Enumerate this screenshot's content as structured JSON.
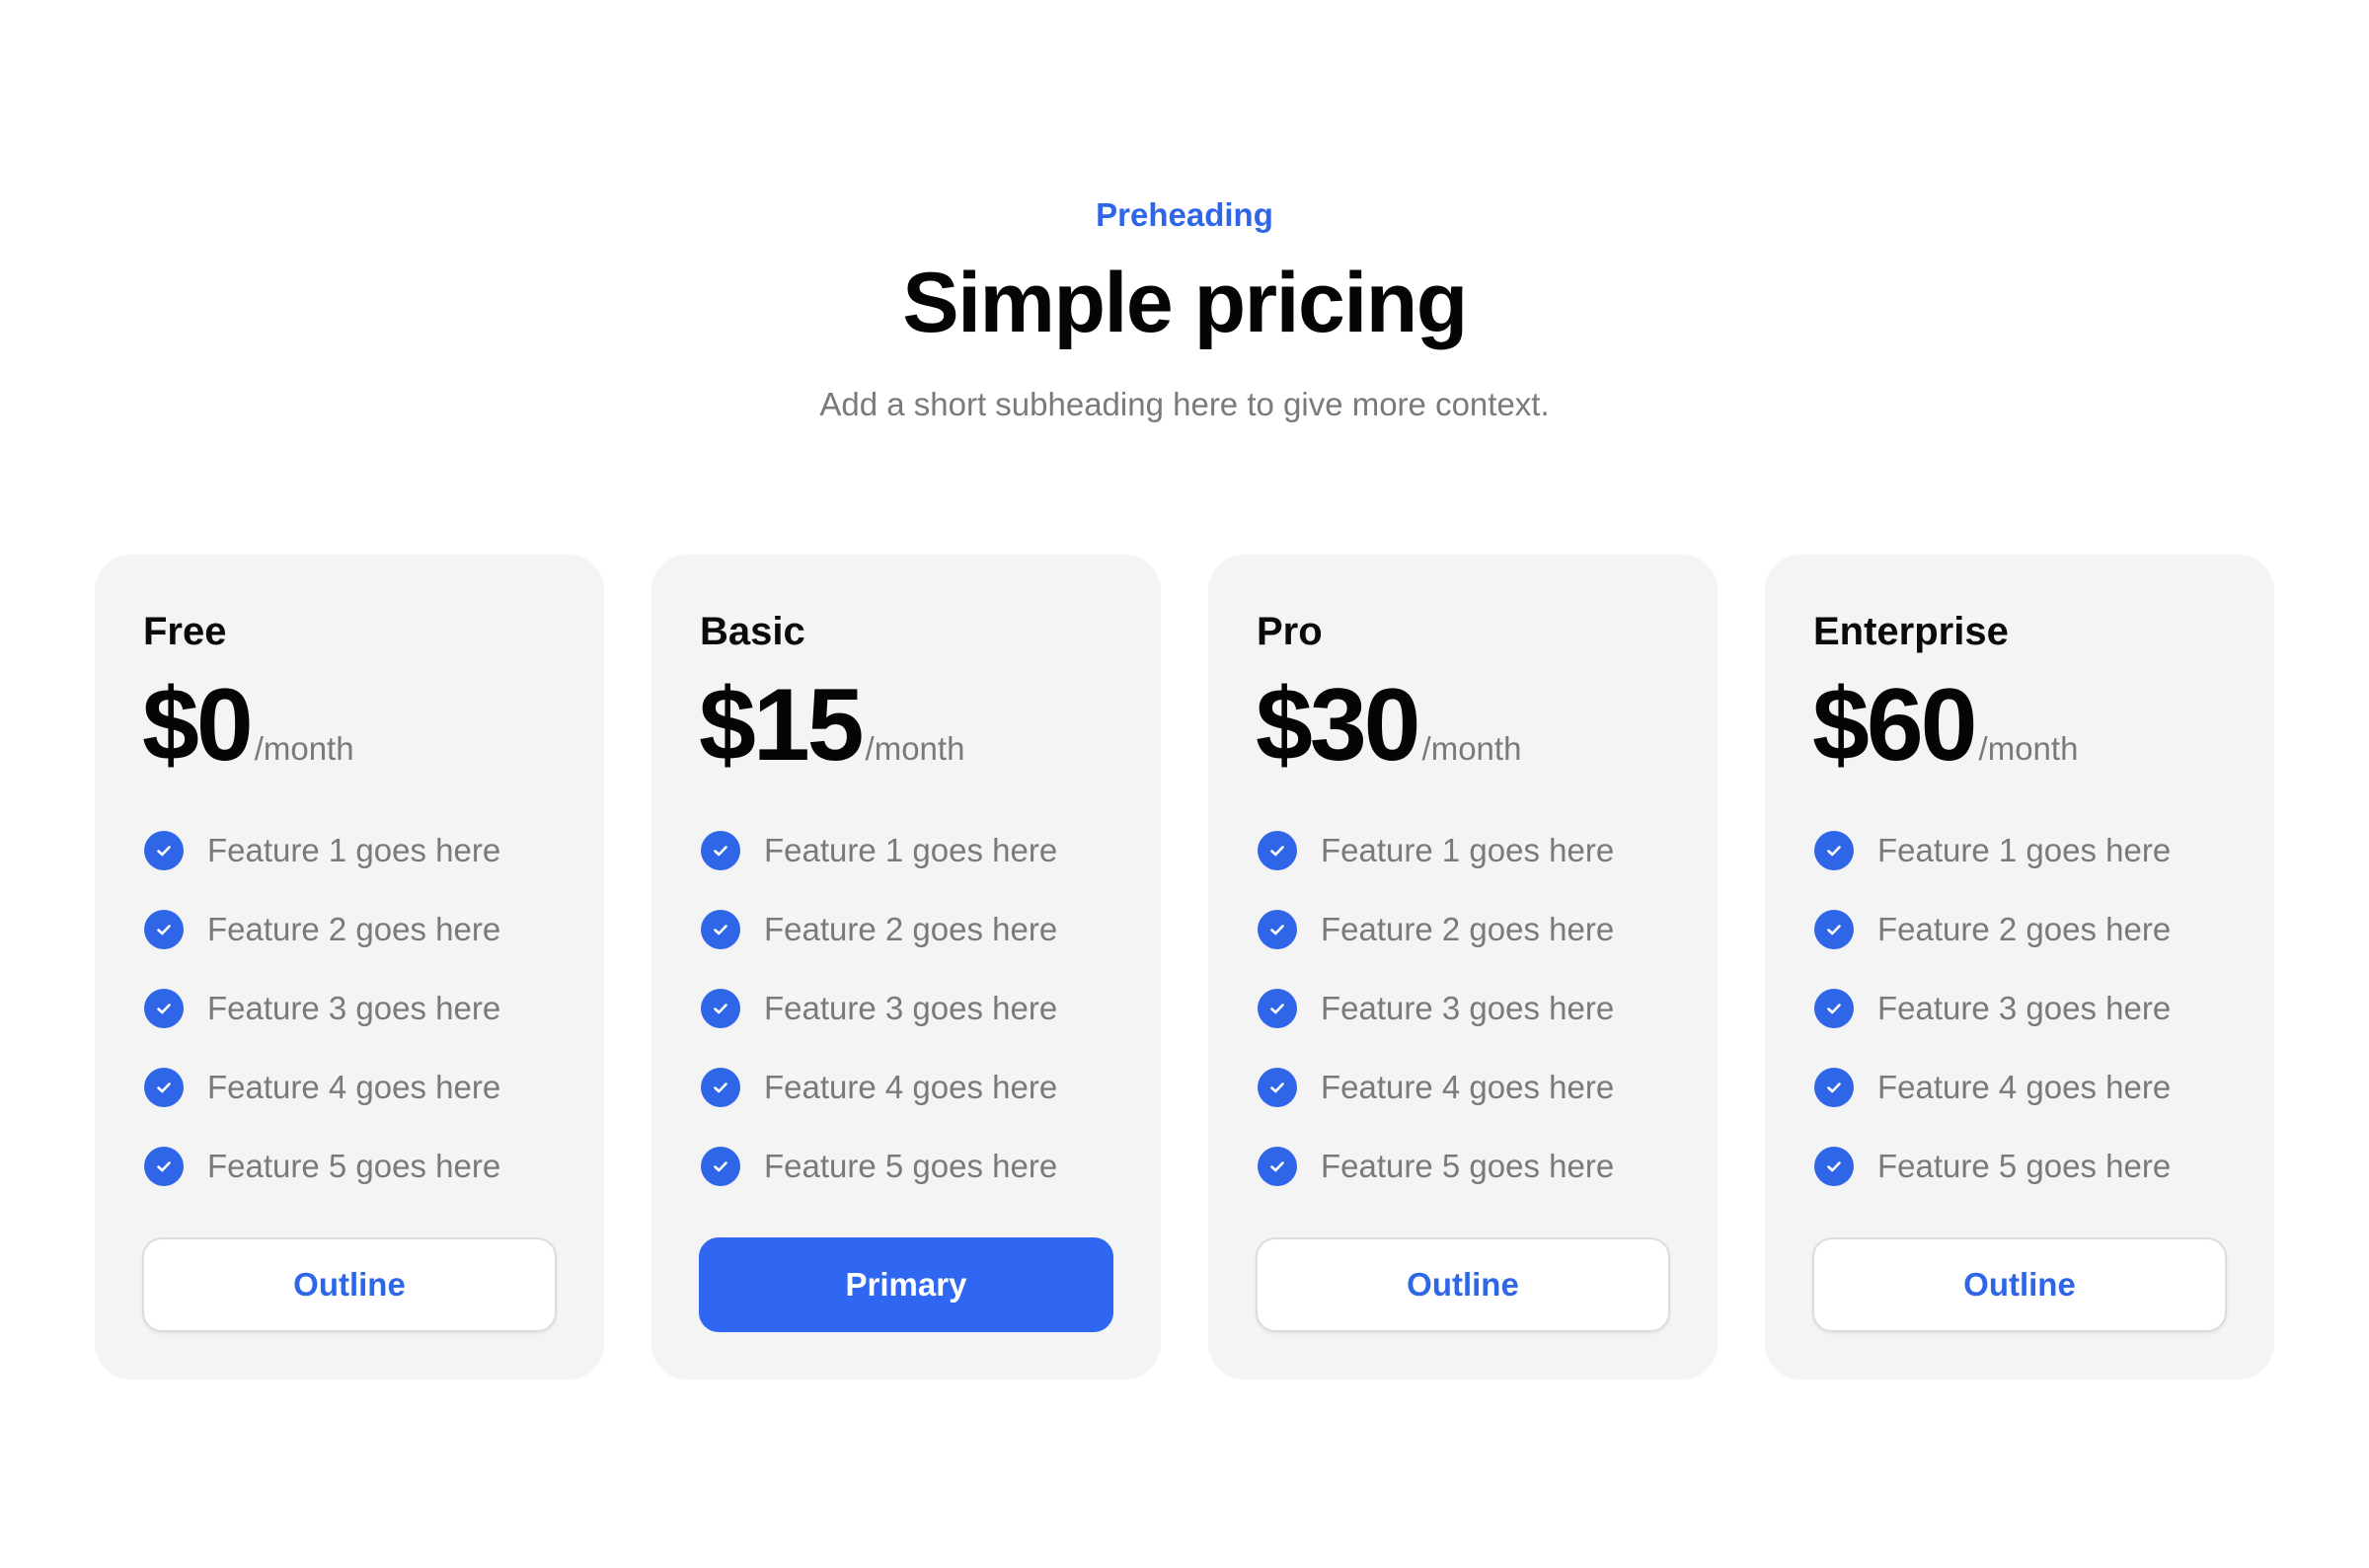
{
  "header": {
    "preheading": "Preheading",
    "title": "Simple pricing",
    "subtitle": "Add a short subheading here to give more context."
  },
  "colors": {
    "accent": "#2f66e8",
    "card_background": "#f4f4f4",
    "muted_text": "#7a7a7a"
  },
  "plans": [
    {
      "name": "Free",
      "price": "$0",
      "period": "/month",
      "features": [
        "Feature 1 goes here",
        "Feature 2 goes here",
        "Feature 3 goes here",
        "Feature 4 goes here",
        "Feature 5 goes here"
      ],
      "button_label": "Outline",
      "button_style": "outline"
    },
    {
      "name": "Basic",
      "price": "$15",
      "period": "/month",
      "features": [
        "Feature 1 goes here",
        "Feature 2 goes here",
        "Feature 3 goes here",
        "Feature 4 goes here",
        "Feature 5 goes here"
      ],
      "button_label": "Primary",
      "button_style": "primary"
    },
    {
      "name": "Pro",
      "price": "$30",
      "period": "/month",
      "features": [
        "Feature 1 goes here",
        "Feature 2 goes here",
        "Feature 3 goes here",
        "Feature 4 goes here",
        "Feature 5 goes here"
      ],
      "button_label": "Outline",
      "button_style": "outline"
    },
    {
      "name": "Enterprise",
      "price": "$60",
      "period": "/month",
      "features": [
        "Feature 1 goes here",
        "Feature 2 goes here",
        "Feature 3 goes here",
        "Feature 4 goes here",
        "Feature 5 goes here"
      ],
      "button_label": "Outline",
      "button_style": "outline"
    }
  ],
  "icons": {
    "feature_icon": "check-circle-icon"
  }
}
